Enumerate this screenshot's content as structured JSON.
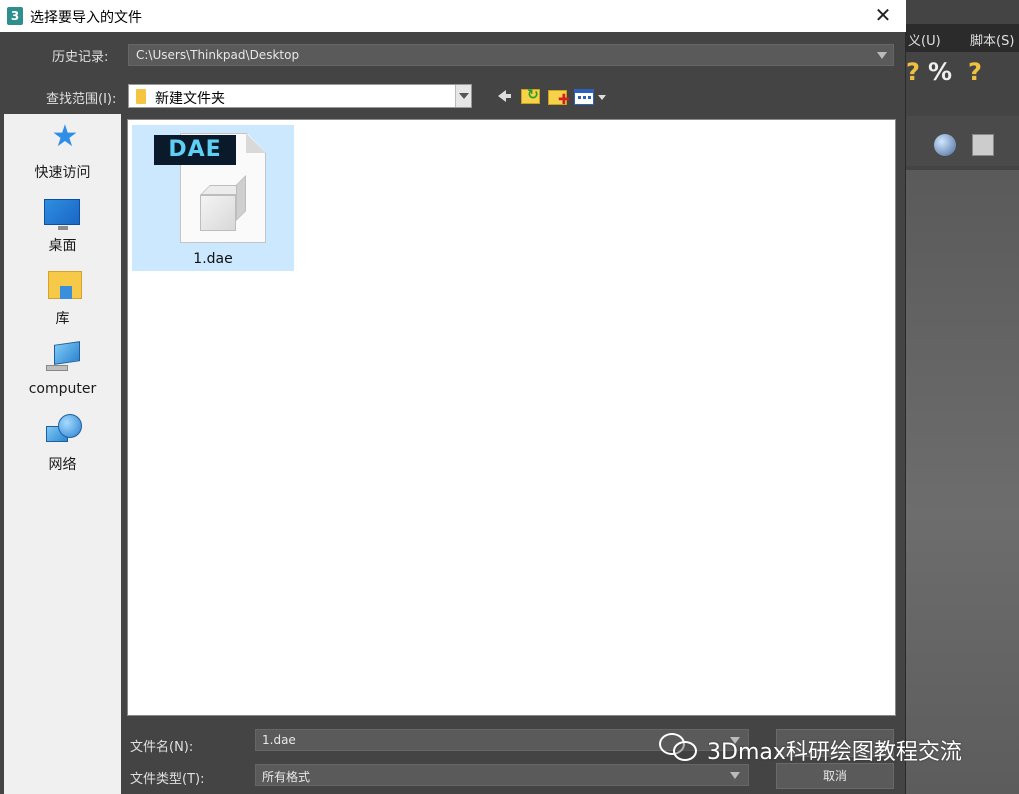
{
  "title_bar": {
    "app_icon": "3",
    "title": "选择要导入的文件",
    "close_glyph": "✕"
  },
  "history": {
    "label": "历史记录:",
    "value": "C:\\Users\\Thinkpad\\Desktop"
  },
  "look_in": {
    "label": "查找范围(I):",
    "value": "新建文件夹"
  },
  "toolbar": {
    "icons": [
      "back-arrow-icon",
      "up-folder-icon",
      "new-folder-icon",
      "view-menu-icon"
    ]
  },
  "places": [
    {
      "label": "快速访问",
      "icon": "star-icon"
    },
    {
      "label": "桌面",
      "icon": "desktop-icon"
    },
    {
      "label": "库",
      "icon": "library-icon"
    },
    {
      "label": "computer",
      "icon": "computer-icon"
    },
    {
      "label": "网络",
      "icon": "network-icon"
    }
  ],
  "files": [
    {
      "name": "1.dae",
      "badge": "DAE",
      "selected": true
    }
  ],
  "file_name": {
    "label": "文件名(N):",
    "value": "1.dae"
  },
  "file_type": {
    "label": "文件类型(T):",
    "value": "所有格式"
  },
  "buttons": {
    "cancel": "取消"
  },
  "background_app": {
    "menu": [
      "义(U)",
      "脚本(S)"
    ]
  },
  "watermark": {
    "text": "3Dmax科研绘图教程交流"
  },
  "colors": {
    "selection": "#cce8ff",
    "dialog_bg": "#444444",
    "accent": "#2f8fe6"
  }
}
